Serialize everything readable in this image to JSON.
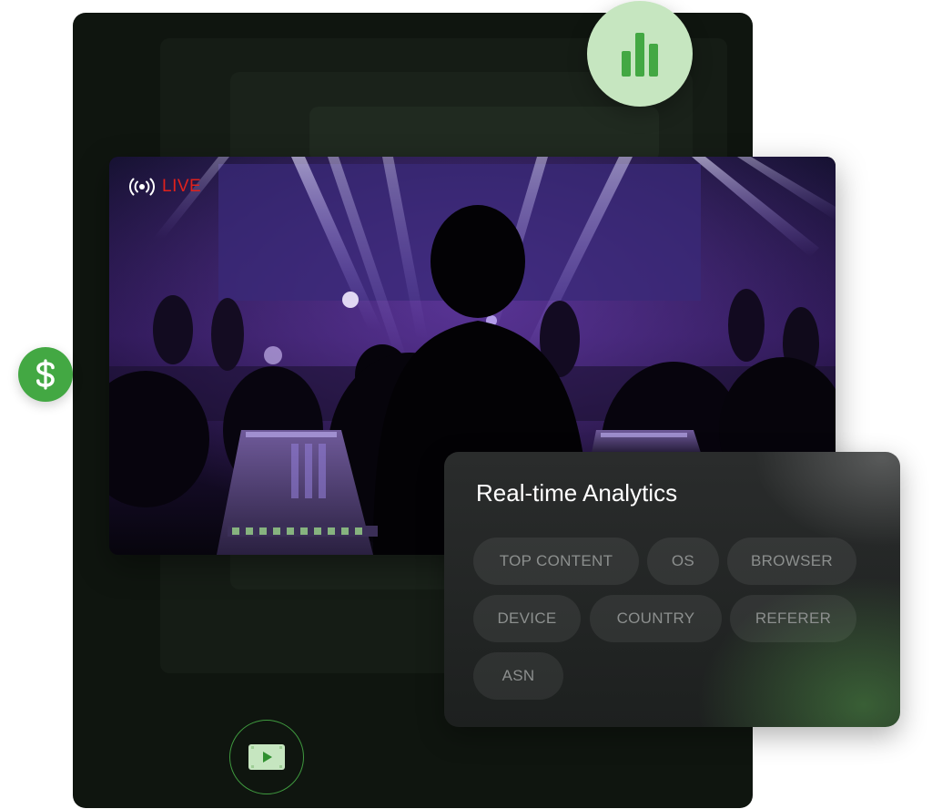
{
  "live_badge": {
    "label": "LIVE",
    "icon": "broadcast-icon",
    "color": "#e0211c"
  },
  "analytics": {
    "title": "Real-time Analytics",
    "chips": [
      {
        "label": "TOP CONTENT"
      },
      {
        "label": "OS"
      },
      {
        "label": "BROWSER"
      },
      {
        "label": "DEVICE"
      },
      {
        "label": "COUNTRY"
      },
      {
        "label": "REFERER"
      },
      {
        "label": "ASN"
      }
    ]
  },
  "icons": {
    "chart": "bar-chart-icon",
    "dollar": "dollar-icon",
    "video": "play-video-icon"
  },
  "colors": {
    "accent_green": "#43a843",
    "light_green": "#c6e6c0",
    "panel_dark": "#0f150f",
    "live_red": "#e0211c"
  }
}
